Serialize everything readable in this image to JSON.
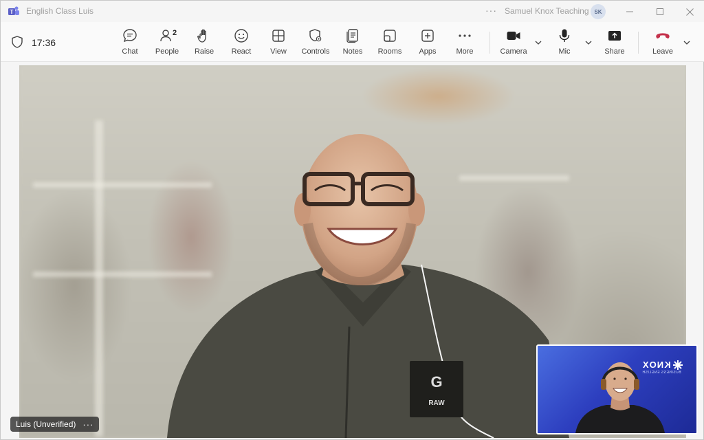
{
  "window": {
    "title": "English Class Luis",
    "user_name": "Samuel Knox Teaching",
    "user_initials": "SK",
    "more_icon": "ellipsis-icon"
  },
  "toolbar": {
    "time": "17:36",
    "buttons": [
      {
        "id": "chat",
        "label": "Chat",
        "icon": "chat-icon"
      },
      {
        "id": "people",
        "label": "People",
        "icon": "people-icon",
        "badge": "2"
      },
      {
        "id": "raise",
        "label": "Raise",
        "icon": "raise-hand-icon"
      },
      {
        "id": "react",
        "label": "React",
        "icon": "react-smiley-icon"
      },
      {
        "id": "view",
        "label": "View",
        "icon": "view-grid-icon"
      },
      {
        "id": "controls",
        "label": "Controls",
        "icon": "controls-shield-icon"
      },
      {
        "id": "notes",
        "label": "Notes",
        "icon": "notes-icon"
      },
      {
        "id": "rooms",
        "label": "Rooms",
        "icon": "rooms-icon"
      },
      {
        "id": "apps",
        "label": "Apps",
        "icon": "apps-plus-icon"
      },
      {
        "id": "more",
        "label": "More",
        "icon": "more-icon"
      },
      {
        "id": "camera",
        "label": "Camera",
        "icon": "camera-icon"
      },
      {
        "id": "mic",
        "label": "Mic",
        "icon": "mic-icon"
      },
      {
        "id": "share",
        "label": "Share",
        "icon": "share-icon"
      },
      {
        "id": "leave",
        "label": "Leave",
        "icon": "leave-phone-icon"
      }
    ]
  },
  "stage": {
    "participant_name": "Luis (Unverified)",
    "participant_options": "···"
  },
  "self_view": {
    "brand": "KNOX",
    "brand_sub": "BUSINESS ENGLISH"
  },
  "colors": {
    "leave_red": "#c4314b",
    "self_view_blue": "#2d3fbf"
  }
}
